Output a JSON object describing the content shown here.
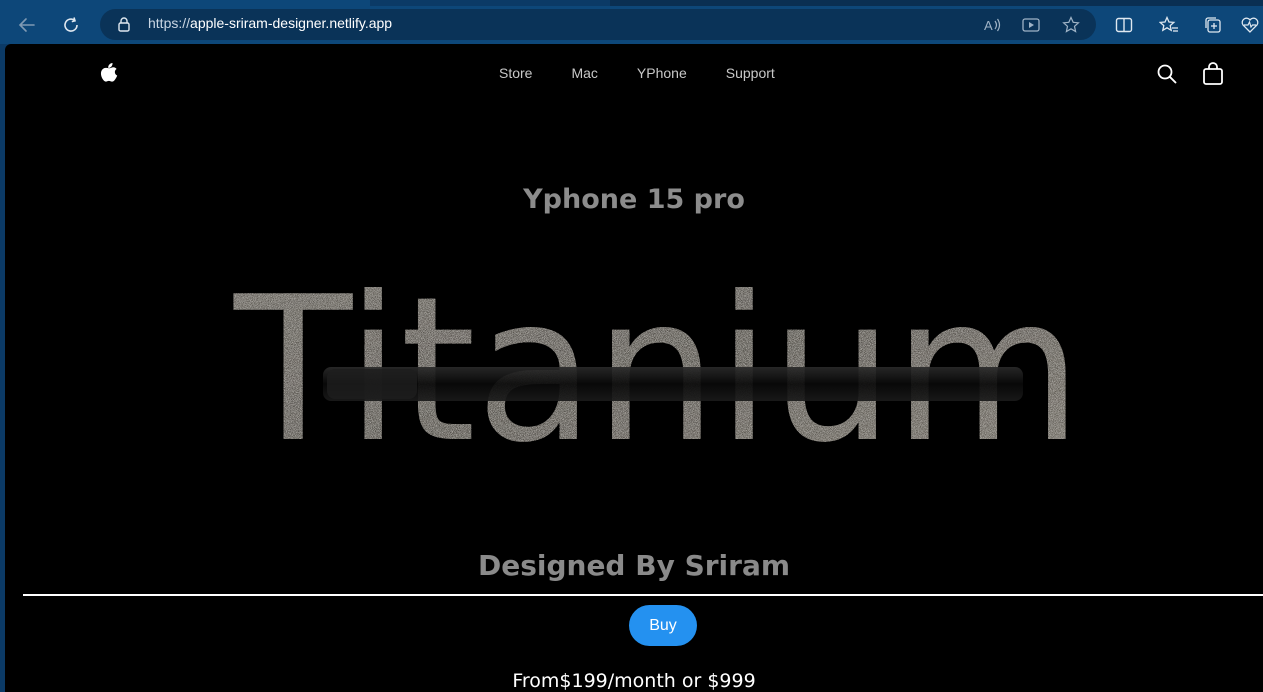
{
  "browser": {
    "url_scheme": "https://",
    "url_host": "apple-sriram-designer.netlify.app",
    "icons": {
      "back": "back-arrow-icon",
      "refresh": "refresh-icon",
      "lock": "lock-icon",
      "read_aloud": "read-aloud-icon",
      "media": "media-icon",
      "favorite": "star-icon",
      "split": "split-screen-icon",
      "favorites": "favorites-icon",
      "collections": "collections-icon",
      "performance": "heart-pulse-icon"
    },
    "colors": {
      "frame": "#0b3a66",
      "toolbar": "#0d4779",
      "address": "#0a3358"
    }
  },
  "nav": {
    "logo_icon": "apple-logo-icon",
    "links": [
      "Store",
      "Mac",
      "YPhone",
      "Support"
    ],
    "search_icon": "search-icon",
    "bag_icon": "shopping-bag-icon"
  },
  "hero": {
    "subtitle": "Yphone 15 pro",
    "headline": "Titanium",
    "designed_by": "Designed By Sriram",
    "buy_label": "Buy",
    "price_text": "From$199/month or $999"
  },
  "colors": {
    "background": "#000000",
    "accent": "#2491f0",
    "muted_text": "#8c8c8c",
    "titanium": "#8a857c"
  }
}
